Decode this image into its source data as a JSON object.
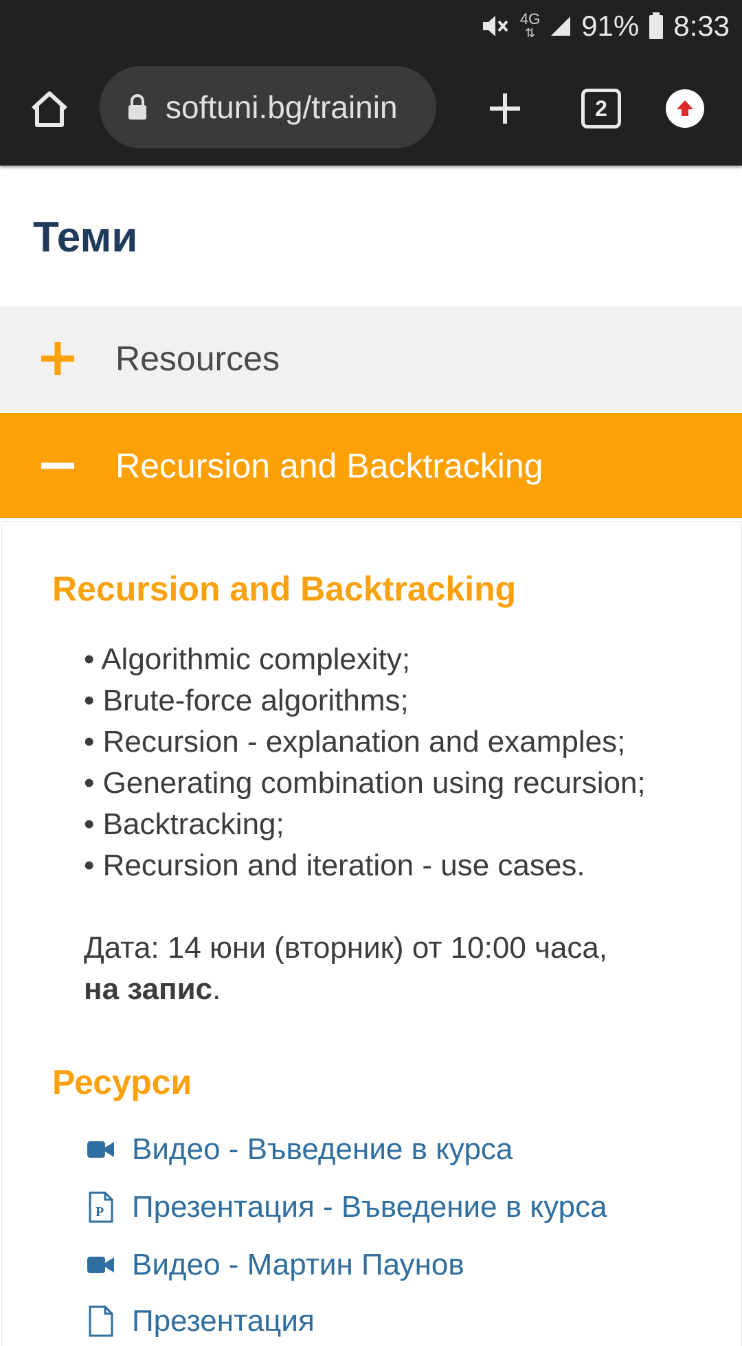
{
  "status_bar": {
    "network": "4G",
    "battery": "91%",
    "time": "8:33"
  },
  "browser": {
    "url": "softuni.bg/trainin",
    "tab_count": "2"
  },
  "page": {
    "title": "Теми",
    "accordion": [
      {
        "label": "Resources",
        "state": "collapsed",
        "icon": "plus-icon"
      },
      {
        "label": "Recursion and Backtracking",
        "state": "expanded",
        "icon": "minus-icon"
      }
    ],
    "section": {
      "heading": "Recursion and Backtracking",
      "topics": [
        "Algorithmic complexity;",
        "Brute-force algorithms;",
        "Recursion - explanation and examples;",
        "Generating combination using recursion;",
        "Backtracking;",
        "Recursion and iteration - use cases."
      ],
      "date_text": "Дата: 14 юни (вторник) от 10:00 часа,",
      "date_bold": "на запис",
      "date_end": "."
    },
    "resources": {
      "heading": "Ресурси",
      "links": [
        {
          "label": "Видео - Въведение в курса",
          "icon": "video-icon"
        },
        {
          "label": "Презентация - Въведение в курса",
          "icon": "presentation-icon"
        },
        {
          "label": "Видео - Мартин Паунов",
          "icon": "video-icon"
        },
        {
          "label": "Презентация",
          "icon": "presentation-icon"
        }
      ]
    }
  },
  "colors": {
    "accent_orange": "#fda106",
    "heading_orange": "#f9a10e",
    "title_navy": "#1f3a5a",
    "link_blue": "#2f6e9f",
    "toolbar_dark": "#212121"
  }
}
